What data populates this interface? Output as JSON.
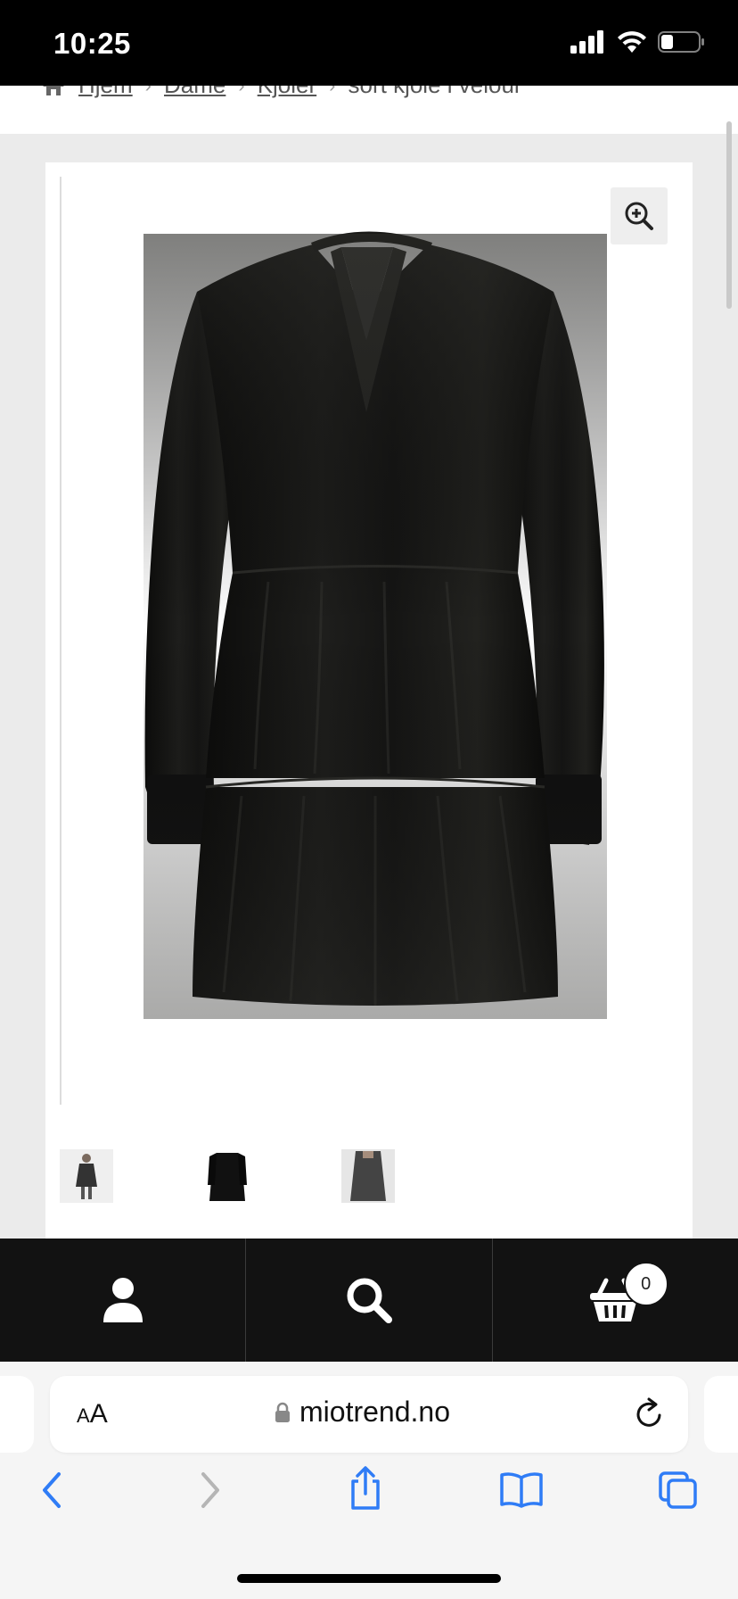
{
  "status": {
    "time": "10:25"
  },
  "breadcrumb": {
    "items": [
      "Hjem",
      "Dame",
      "Kjoler"
    ],
    "current": "sort kjole i velour"
  },
  "product": {
    "thumbnail_count": 3
  },
  "bottom_nav": {
    "account_icon": "user-icon",
    "search_icon": "search-icon",
    "cart_icon": "basket-icon",
    "cart_count": "0"
  },
  "browser": {
    "text_size_label_small": "A",
    "text_size_label_large": "A",
    "url": "miotrend.no"
  },
  "colors": {
    "nav_bg": "#121212",
    "page_bg": "#ebebeb",
    "ios_blue": "#2f7cf6"
  }
}
